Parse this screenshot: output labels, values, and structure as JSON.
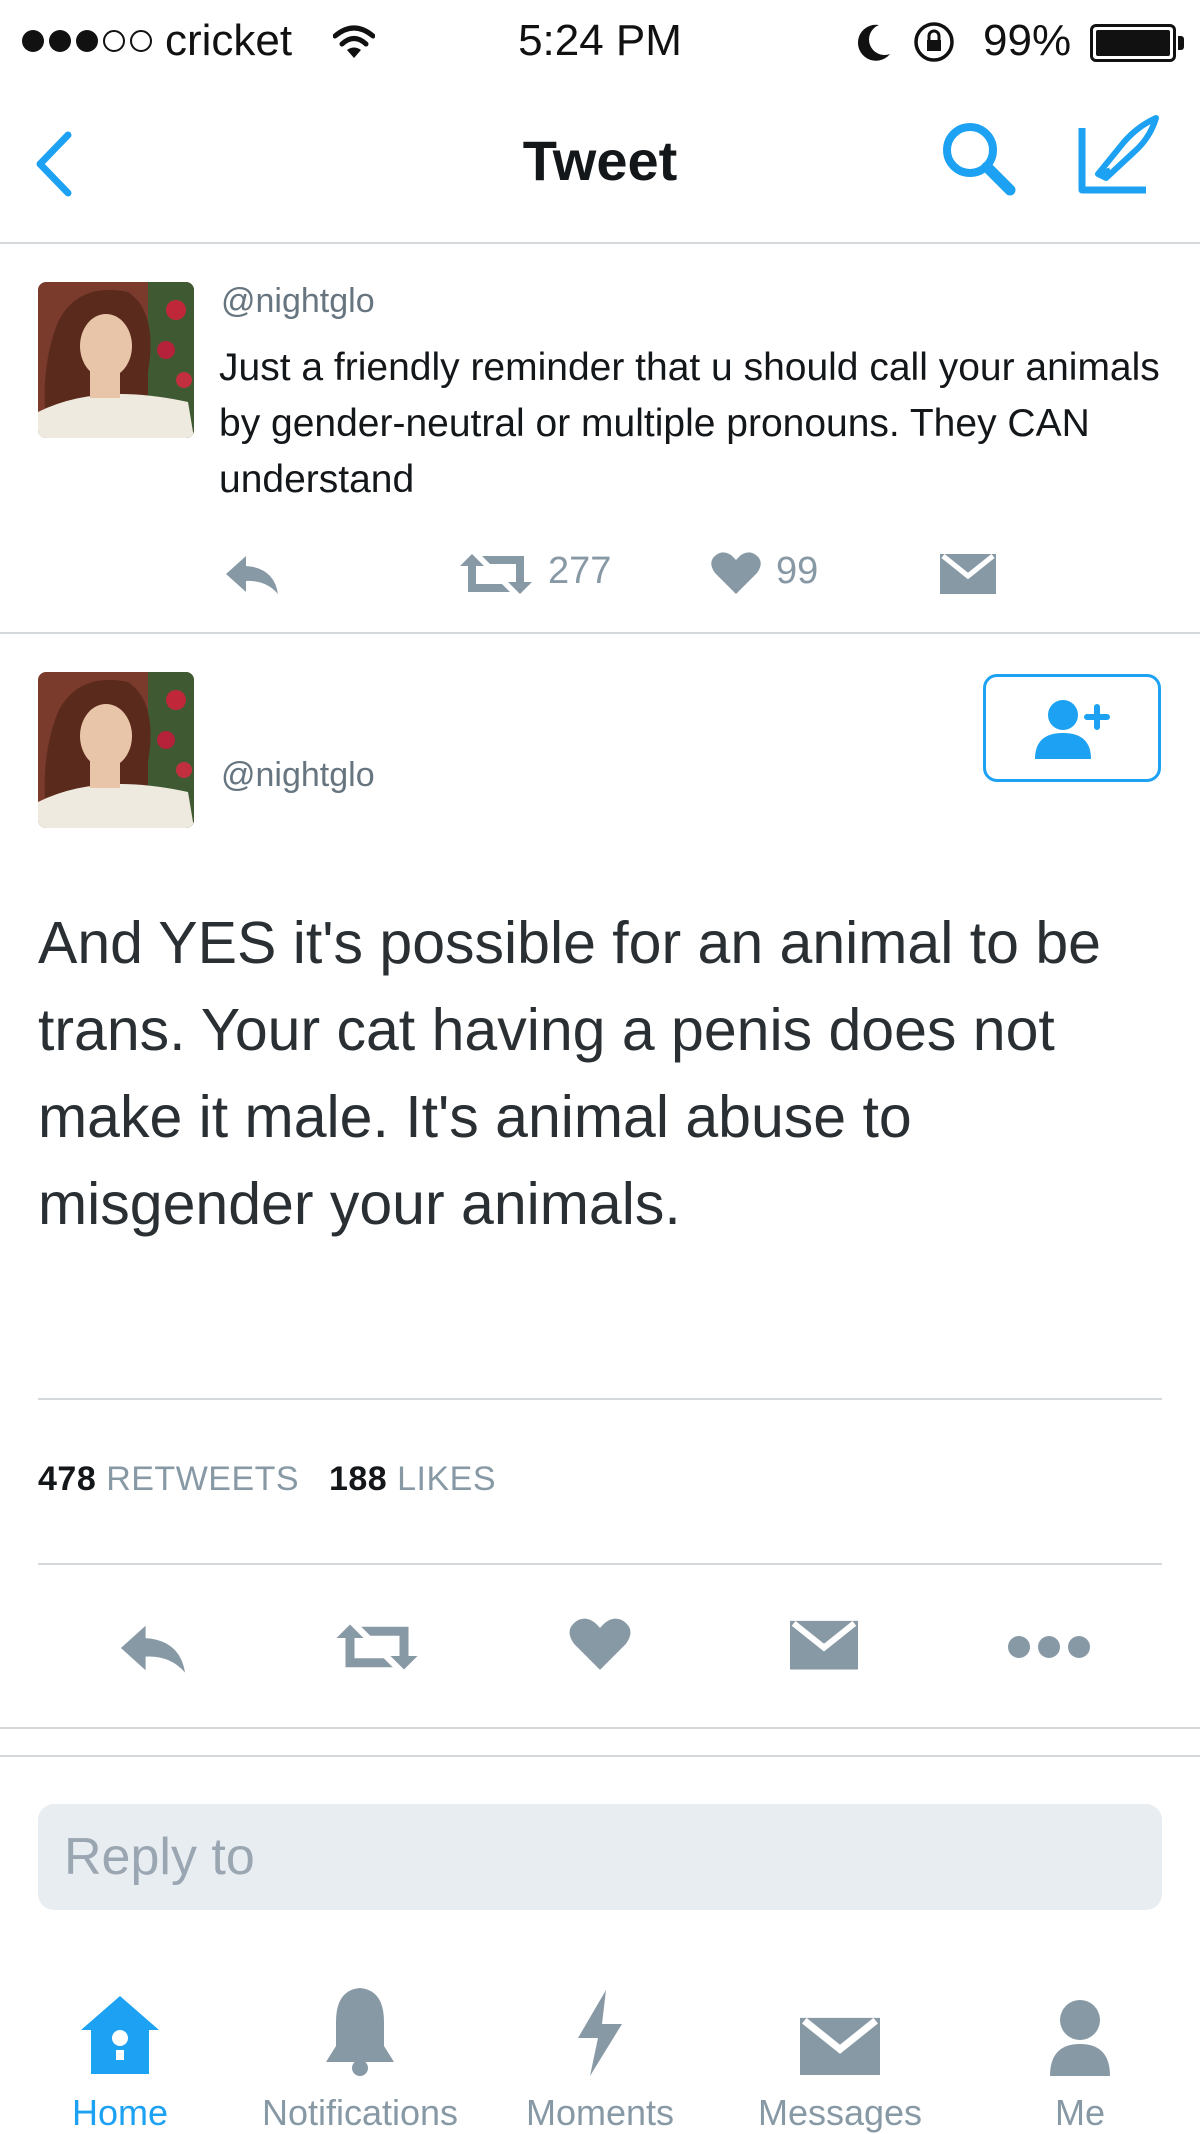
{
  "status_bar": {
    "carrier": "cricket",
    "time": "5:24 PM",
    "battery": "99%"
  },
  "nav": {
    "title": "Tweet"
  },
  "parent_tweet": {
    "handle": "@nightglo",
    "text": "Just a friendly reminder that u should call your animals by gender-neutral or multiple pronouns. They CAN understand",
    "retweets": "277",
    "likes": "99"
  },
  "main_tweet": {
    "handle": "@nightglo",
    "text": "And YES it's possible for an animal to be trans. Your cat having a penis does not make it male. It's animal abuse to misgender your animals.",
    "retweet_count": "478",
    "retweet_label": "RETWEETS",
    "like_count": "188",
    "like_label": "LIKES"
  },
  "reply": {
    "placeholder": "Reply to"
  },
  "tab_bar": {
    "items": [
      {
        "label": "Home",
        "icon": "home-icon"
      },
      {
        "label": "Notifications",
        "icon": "bell-icon"
      },
      {
        "label": "Moments",
        "icon": "lightning-icon"
      },
      {
        "label": "Messages",
        "icon": "envelope-icon"
      },
      {
        "label": "Me",
        "icon": "person-icon"
      }
    ]
  },
  "colors": {
    "accent": "#1da1f2",
    "icon_gray": "#8899a6",
    "reply_bg": "#e8edf2"
  }
}
